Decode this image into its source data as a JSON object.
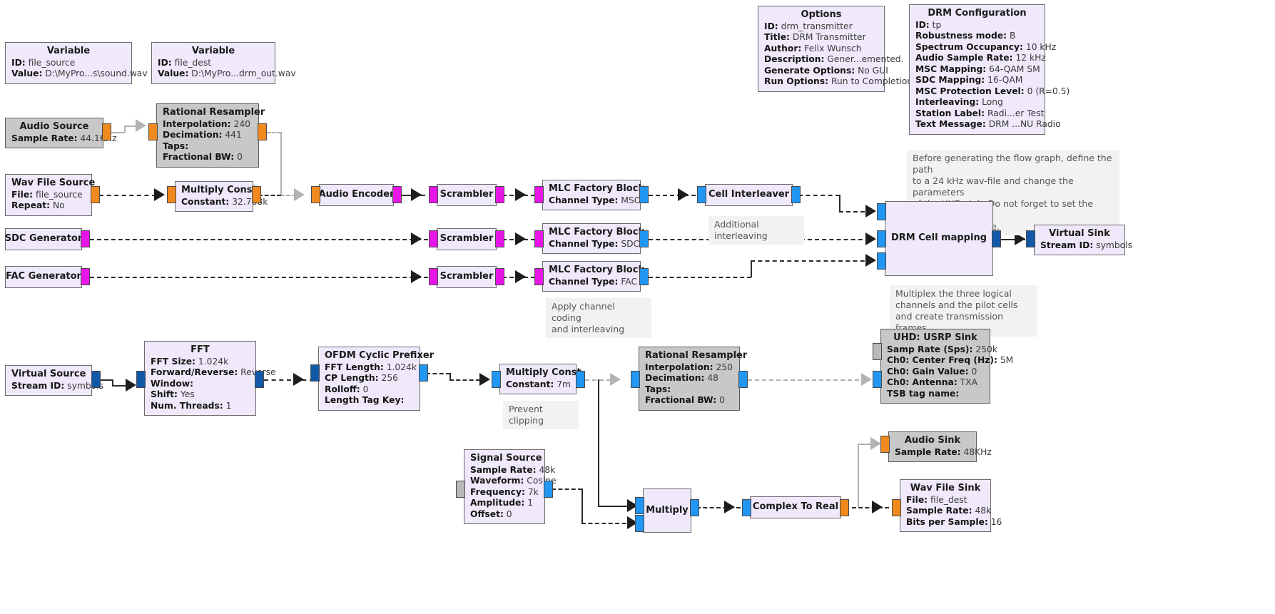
{
  "app": {
    "kind": "gnuradio-companion-flowgraph",
    "title": "DRM Transmitter"
  },
  "options_block": {
    "title": "Options",
    "params": [
      {
        "key": "ID:",
        "value": "drm_transmitter"
      },
      {
        "key": "Title:",
        "value": "DRM Transmitter"
      },
      {
        "key": "Author:",
        "value": "Felix Wunsch"
      },
      {
        "key": "Description:",
        "value": "Gener...emented."
      },
      {
        "key": "Generate Options:",
        "value": "No GUI"
      },
      {
        "key": "Run Options:",
        "value": "Run to Completion"
      }
    ]
  },
  "drm_config_block": {
    "title": "DRM Configuration",
    "params": [
      {
        "key": "ID:",
        "value": "tp"
      },
      {
        "key": "Robustness mode:",
        "value": "B"
      },
      {
        "key": "Spectrum Occupancy:",
        "value": "10 kHz"
      },
      {
        "key": "Audio Sample Rate:",
        "value": "12 kHz"
      },
      {
        "key": "MSC Mapping:",
        "value": "64-QAM SM"
      },
      {
        "key": "SDC Mapping:",
        "value": "16-QAM"
      },
      {
        "key": "MSC Protection Level:",
        "value": "0 (R=0.5)"
      },
      {
        "key": "Interleaving:",
        "value": "Long"
      },
      {
        "key": "Station Label:",
        "value": "Radi...er Test"
      },
      {
        "key": "Text Message:",
        "value": "DRM ...NU Radio"
      }
    ]
  },
  "variable_file_source": {
    "title": "Variable",
    "params": [
      {
        "key": "ID:",
        "value": "file_source"
      },
      {
        "key": "Value:",
        "value": "D:\\MyPro...s\\sound.wav"
      }
    ]
  },
  "variable_file_dest": {
    "title": "Variable",
    "params": [
      {
        "key": "ID:",
        "value": "file_dest"
      },
      {
        "key": "Value:",
        "value": "D:\\MyPro...drm_out.wav"
      }
    ]
  },
  "audio_source": {
    "title": "Audio Source",
    "params": [
      {
        "key": "Sample Rate:",
        "value": "44.1KHz"
      }
    ]
  },
  "rational_resampler_top": {
    "title": "Rational Resampler",
    "params": [
      {
        "key": "Interpolation:",
        "value": "240"
      },
      {
        "key": "Decimation:",
        "value": "441"
      },
      {
        "key": "Taps:",
        "value": ""
      },
      {
        "key": "Fractional BW:",
        "value": "0"
      }
    ]
  },
  "wav_file_source": {
    "title": "Wav File Source",
    "params": [
      {
        "key": "File:",
        "value": "file_source"
      },
      {
        "key": "Repeat:",
        "value": "No"
      }
    ]
  },
  "multiply_const_msc": {
    "title": "Multiply Const",
    "params": [
      {
        "key": "Constant:",
        "value": "32.768k"
      }
    ]
  },
  "audio_encoder": {
    "title": "Audio Encoder"
  },
  "scrambler_msc": {
    "title": "Scrambler"
  },
  "scrambler_sdc": {
    "title": "Scrambler"
  },
  "scrambler_fac": {
    "title": "Scrambler"
  },
  "mlc_msc": {
    "title": "MLC Factory Block",
    "params": [
      {
        "key": "Channel Type:",
        "value": "MSC"
      }
    ]
  },
  "mlc_sdc": {
    "title": "MLC Factory Block",
    "params": [
      {
        "key": "Channel Type:",
        "value": "SDC"
      }
    ]
  },
  "mlc_fac": {
    "title": "MLC Factory Block",
    "params": [
      {
        "key": "Channel Type:",
        "value": "FAC"
      }
    ]
  },
  "cell_interleaver": {
    "title": "Cell Interleaver"
  },
  "sdc_generator": {
    "title": "SDC Generator"
  },
  "fac_generator": {
    "title": "FAC Generator"
  },
  "drm_cell_mapping": {
    "title": "DRM Cell mapping"
  },
  "virtual_sink": {
    "title": "Virtual Sink",
    "params": [
      {
        "key": "Stream ID:",
        "value": "symbols"
      }
    ]
  },
  "virtual_source": {
    "title": "Virtual Source",
    "params": [
      {
        "key": "Stream ID:",
        "value": "symbols"
      }
    ]
  },
  "fft_block": {
    "title": "FFT",
    "params": [
      {
        "key": "FFT Size:",
        "value": "1.024k"
      },
      {
        "key": "Forward/Reverse:",
        "value": "Reverse"
      },
      {
        "key": "Window:",
        "value": ""
      },
      {
        "key": "Shift:",
        "value": "Yes"
      },
      {
        "key": "Num. Threads:",
        "value": "1"
      }
    ]
  },
  "ofdm_cyclic_prefixer": {
    "title": "OFDM Cyclic Prefixer",
    "params": [
      {
        "key": "FFT Length:",
        "value": "1.024k"
      },
      {
        "key": "CP Length:",
        "value": "256"
      },
      {
        "key": "Rolloff:",
        "value": "0"
      },
      {
        "key": "Length Tag Key:",
        "value": ""
      }
    ]
  },
  "multiply_const_clip": {
    "title": "Multiply Const",
    "params": [
      {
        "key": "Constant:",
        "value": "7m"
      }
    ]
  },
  "rational_resampler_bottom": {
    "title": "Rational Resampler",
    "params": [
      {
        "key": "Interpolation:",
        "value": "250"
      },
      {
        "key": "Decimation:",
        "value": "48"
      },
      {
        "key": "Taps:",
        "value": ""
      },
      {
        "key": "Fractional BW:",
        "value": "0"
      }
    ]
  },
  "uhd_usrp_sink": {
    "title": "UHD: USRP Sink",
    "params": [
      {
        "key": "Samp Rate (Sps):",
        "value": "250k"
      },
      {
        "key": "Ch0: Center Freq (Hz):",
        "value": "5M"
      },
      {
        "key": "Ch0: Gain Value:",
        "value": "0"
      },
      {
        "key": "Ch0: Antenna:",
        "value": "TXA"
      },
      {
        "key": "TSB tag name:",
        "value": ""
      }
    ]
  },
  "signal_source": {
    "title": "Signal Source",
    "params": [
      {
        "key": "Sample Rate:",
        "value": "48k"
      },
      {
        "key": "Waveform:",
        "value": "Cosine"
      },
      {
        "key": "Frequency:",
        "value": "7k"
      },
      {
        "key": "Amplitude:",
        "value": "1"
      },
      {
        "key": "Offset:",
        "value": "0"
      }
    ]
  },
  "multiply_block": {
    "title": "Multiply"
  },
  "complex_to_real": {
    "title": "Complex To Real"
  },
  "audio_sink": {
    "title": "Audio Sink",
    "params": [
      {
        "key": "Sample Rate:",
        "value": "48KHz"
      }
    ]
  },
  "wav_file_sink": {
    "title": "Wav File Sink",
    "params": [
      {
        "key": "File:",
        "value": "file_dest"
      },
      {
        "key": "Sample Rate:",
        "value": "48k"
      },
      {
        "key": "Bits per Sample:",
        "value": "16"
      }
    ]
  },
  "comments": {
    "uhd_note": "Before generating the flow graph, define the path\nto a 24 kHz wav-file and change the parameters\nof the UHD sink. Do not forget to set the correct\naudio_sample_rate.",
    "additional_interleaving": "Additional interleaving",
    "channel_coding": "Apply channel coding\nand interleaving",
    "multiplex": "Multiplex the three logical\nchannels and the pilot cells\nand create transmission frames.",
    "prevent_clipping": "Prevent clipping"
  },
  "colors": {
    "block_fill": "#efe9fb",
    "block_fill_gray": "#c8c8c8",
    "block_border": "#6b6b6b",
    "port_orange": "#f08a1e",
    "port_magenta": "#e815e8",
    "port_blue": "#2196f3",
    "port_darkblue": "#1258a8",
    "wire": "#2b2b2b",
    "wire_disabled": "#b0b0b0",
    "comment_bg": "#f2f2f2",
    "canvas": "#ffffff"
  }
}
